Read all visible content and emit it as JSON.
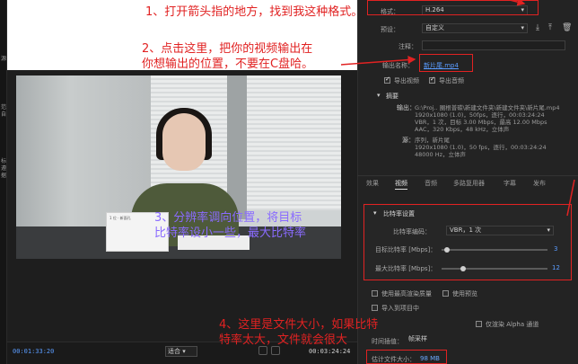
{
  "annotations": {
    "step1": "1、打开箭头指的地方，找到我这种格式。",
    "step2_line1": "2、点击这里，把你的视频输出在",
    "step2_line2": "你想输出的位置，不要在C盘哈。",
    "step3_line1": "3、分辨率调向位置，将目标",
    "step3_line2": "比特率设小一些，最大比特率",
    "step4_line1": "4、这里是文件大小，如果比特",
    "step4_line2": "特率太大，文件就会很大"
  },
  "export": {
    "format_label": "格式：",
    "format_value": "H.264",
    "preset_label": "预设：",
    "preset_value": "自定义",
    "comment_label": "注释：",
    "output_label": "输出名称：",
    "output_value": "新片尾.mp4",
    "export_video": "导出视频",
    "export_audio": "导出音频",
    "summary_title": "摘要",
    "output_summary_label": "输出：",
    "output_summary_lines": [
      "G:\\Proj.. 圈根普碳\\新建文件夹\\新建文件夹\\新片尾.mp4",
      "1920x1080 (1.0)，50fps，逐行，00:03:24:24",
      "VBR，1 次，目标 3.00 Mbps，最高 12.00 Mbps",
      "AAC，320 Kbps，48 kHz，立体声"
    ],
    "source_label": "源：",
    "source_lines": [
      "序列，新片尾",
      "1920x1080 (1.0)，50 fps，逐行，00:03:24:24",
      "48000 Hz，立体声"
    ]
  },
  "tabs": [
    "效果",
    "视频",
    "音频",
    "多路复用器",
    "字幕",
    "发布"
  ],
  "bitrate": {
    "section_title": "比特率设置",
    "encoding_label": "比特率编码：",
    "encoding_value": "VBR，1 次",
    "target_label": "目标比特率 [Mbps]：",
    "target_value": "3",
    "target_fraction": 0.05,
    "max_label": "最大比特率 [Mbps]：",
    "max_value": "12",
    "max_fraction": 0.2
  },
  "options": {
    "max_render": "使用最高渲染质量",
    "use_preview": "使用预览",
    "import_project": "导入到项目中",
    "alpha_only": "仅渲染 Alpha 通道",
    "time_interp_label": "时间插值：",
    "time_interp_value": "帧采样",
    "file_size_label": "估计文件大小：",
    "file_size_value": "98 MB"
  },
  "timeline": {
    "timecode_left": "00:01:33:20",
    "timecode_right": "00:03:24:24",
    "fit_label": "适合"
  },
  "left_strip": [
    "源",
    "范",
    "自",
    "标",
    "遵",
    "据"
  ],
  "preview_paper_text": "1 位 · 新面孔"
}
